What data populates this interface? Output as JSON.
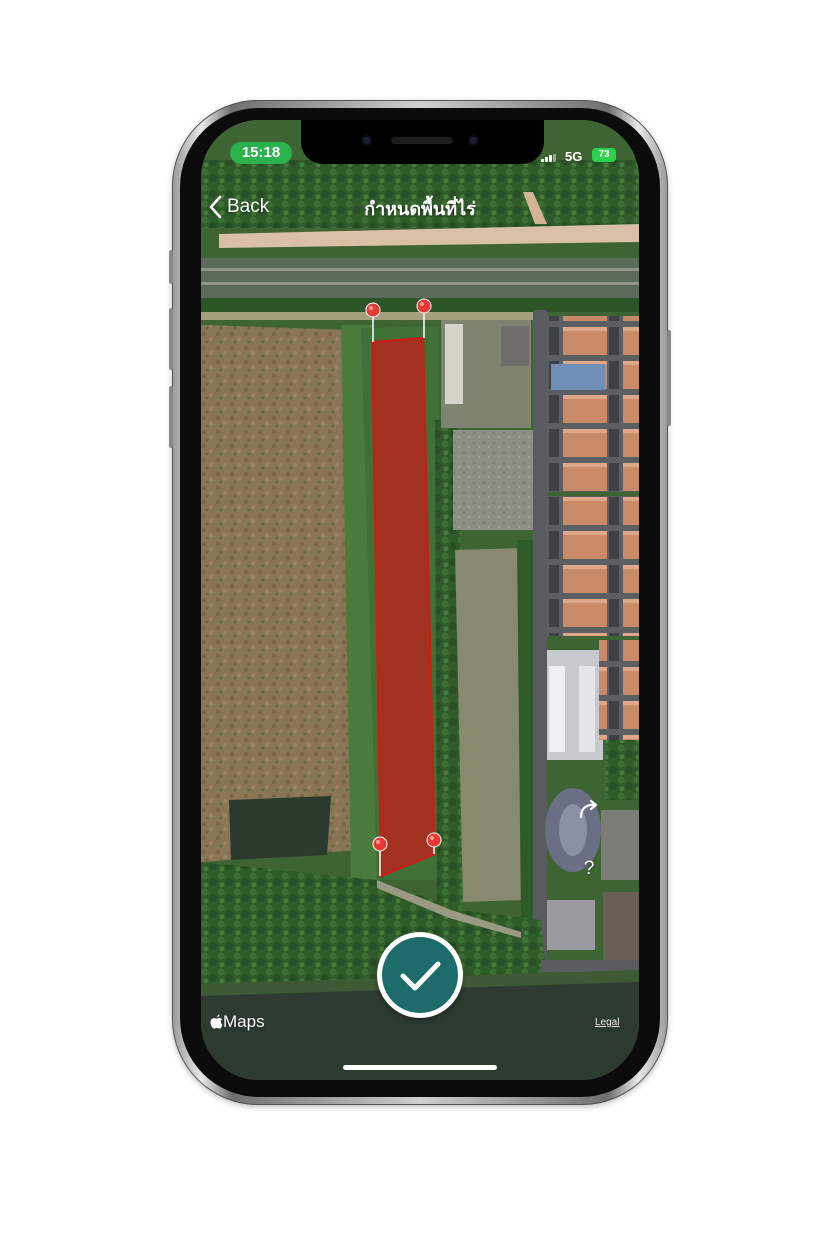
{
  "status_bar": {
    "time": "15:18",
    "network": "5G",
    "battery": "73"
  },
  "nav": {
    "back_label": "Back",
    "title": "กำหนดพื้นที่ไร่"
  },
  "map": {
    "attribution": "Maps",
    "legal_label": "Legal",
    "plot_color": "#b0281f"
  },
  "controls": {
    "rotate_icon": "rotate-arrow-icon",
    "help_label": "?",
    "confirm_icon": "checkmark-icon"
  },
  "colors": {
    "status_pill": "#2bb24c",
    "battery": "#2bd14c",
    "confirm_button": "#1d6b6b",
    "pin": "#e53935"
  }
}
